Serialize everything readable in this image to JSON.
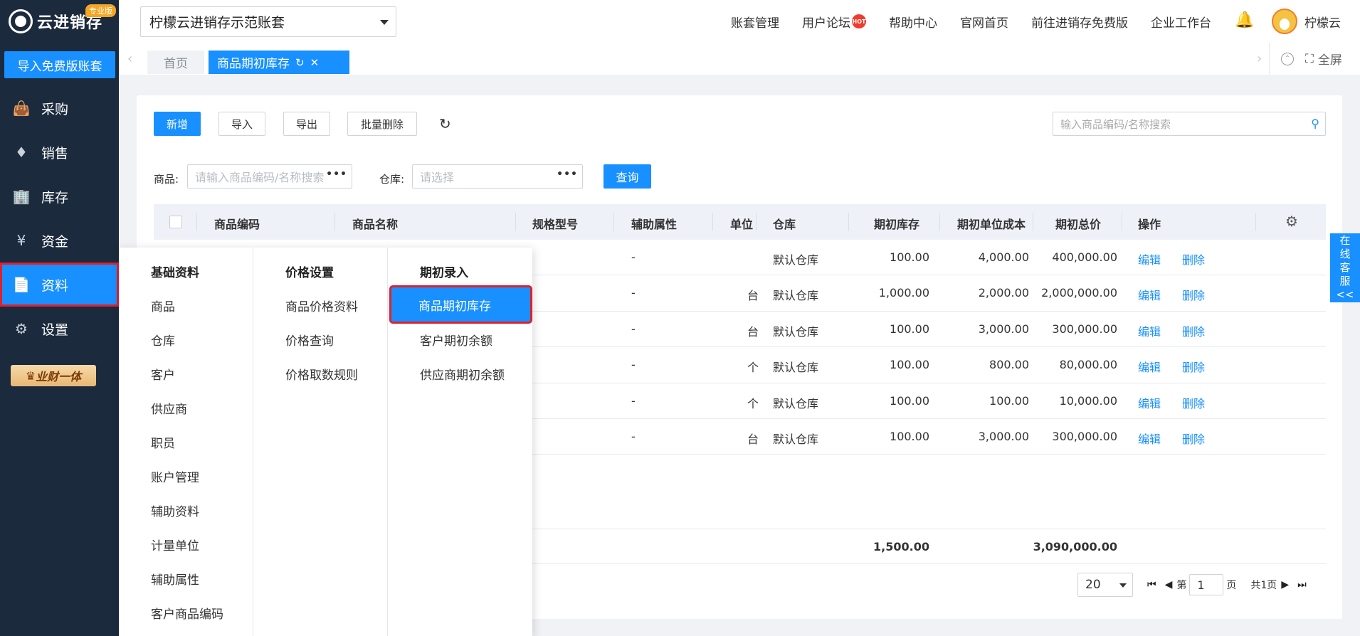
{
  "sidebar": {
    "logo_text": "云进销存",
    "badge": "专业版",
    "import_button": "导入免费版账套",
    "items": [
      {
        "label": "采购",
        "icon": "bag-icon"
      },
      {
        "label": "销售",
        "icon": "tag-icon"
      },
      {
        "label": "库存",
        "icon": "warehouse-icon"
      },
      {
        "label": "资金",
        "icon": "yen-icon"
      },
      {
        "label": "资料",
        "icon": "document-icon",
        "active": true
      },
      {
        "label": "设置",
        "icon": "gear-icon"
      }
    ],
    "promo": "业财一体"
  },
  "header": {
    "account": "柠檬云进销存示范账套",
    "links": [
      "账套管理",
      "用户论坛",
      "帮助中心",
      "官网首页",
      "前往进销存免费版",
      "企业工作台"
    ],
    "hot": "HOT",
    "user_name": "柠檬云"
  },
  "tabs": {
    "home": "首页",
    "current": "商品期初库存",
    "fullscreen": "全屏"
  },
  "toolbar": {
    "add": "新增",
    "import": "导入",
    "export": "导出",
    "batch_delete": "批量删除",
    "search_placeholder": "输入商品编码/名称搜索"
  },
  "filters": {
    "product_label": "商品:",
    "product_placeholder": "请输入商品编码/名称搜索",
    "warehouse_label": "仓库:",
    "warehouse_placeholder": "请选择",
    "query": "查询"
  },
  "table": {
    "columns": [
      "商品编码",
      "商品名称",
      "规格型号",
      "辅助属性",
      "单位",
      "仓库",
      "期初库存",
      "期初单位成本",
      "期初总价",
      "操作"
    ],
    "rows": [
      {
        "attr": "-",
        "unit": "",
        "warehouse": "默认仓库",
        "qty": "100.00",
        "cost": "4,000.00",
        "total": "400,000.00",
        "edit": "编辑",
        "del": "删除"
      },
      {
        "attr": "-",
        "unit": "台",
        "warehouse": "默认仓库",
        "qty": "1,000.00",
        "cost": "2,000.00",
        "total": "2,000,000.00",
        "edit": "编辑",
        "del": "删除"
      },
      {
        "attr": "-",
        "unit": "台",
        "warehouse": "默认仓库",
        "qty": "100.00",
        "cost": "3,000.00",
        "total": "300,000.00",
        "edit": "编辑",
        "del": "删除"
      },
      {
        "attr": "-",
        "unit": "个",
        "warehouse": "默认仓库",
        "qty": "100.00",
        "cost": "800.00",
        "total": "80,000.00",
        "edit": "编辑",
        "del": "删除"
      },
      {
        "attr": "-",
        "unit": "个",
        "warehouse": "默认仓库",
        "qty": "100.00",
        "cost": "100.00",
        "total": "10,000.00",
        "edit": "编辑",
        "del": "删除"
      },
      {
        "attr": "-",
        "unit": "台",
        "warehouse": "默认仓库",
        "qty": "100.00",
        "cost": "3,000.00",
        "total": "300,000.00",
        "edit": "编辑",
        "del": "删除"
      }
    ],
    "totals": {
      "qty": "1,500.00",
      "total": "3,090,000.00"
    }
  },
  "pager": {
    "page_size": "20",
    "page_prefix": "第",
    "page": "1",
    "page_suffix": "页",
    "total_pages": "共1页"
  },
  "service": [
    "在",
    "线",
    "客",
    "服",
    "<<"
  ],
  "menu": {
    "col1": {
      "title": "基础资料",
      "items": [
        "商品",
        "仓库",
        "客户",
        "供应商",
        "职员",
        "账户管理",
        "辅助资料",
        "计量单位",
        "辅助属性",
        "客户商品编码"
      ]
    },
    "col2": {
      "title": "价格设置",
      "items": [
        "商品价格资料",
        "价格查询",
        "价格取数规则"
      ]
    },
    "col3": {
      "title": "期初录入",
      "items": [
        "商品期初库存",
        "客户期初余额",
        "供应商期初余额"
      ]
    }
  },
  "colors": {
    "primary": "#1890ff",
    "sidebar": "#1b2a3d",
    "highlight": "#e0202a"
  }
}
